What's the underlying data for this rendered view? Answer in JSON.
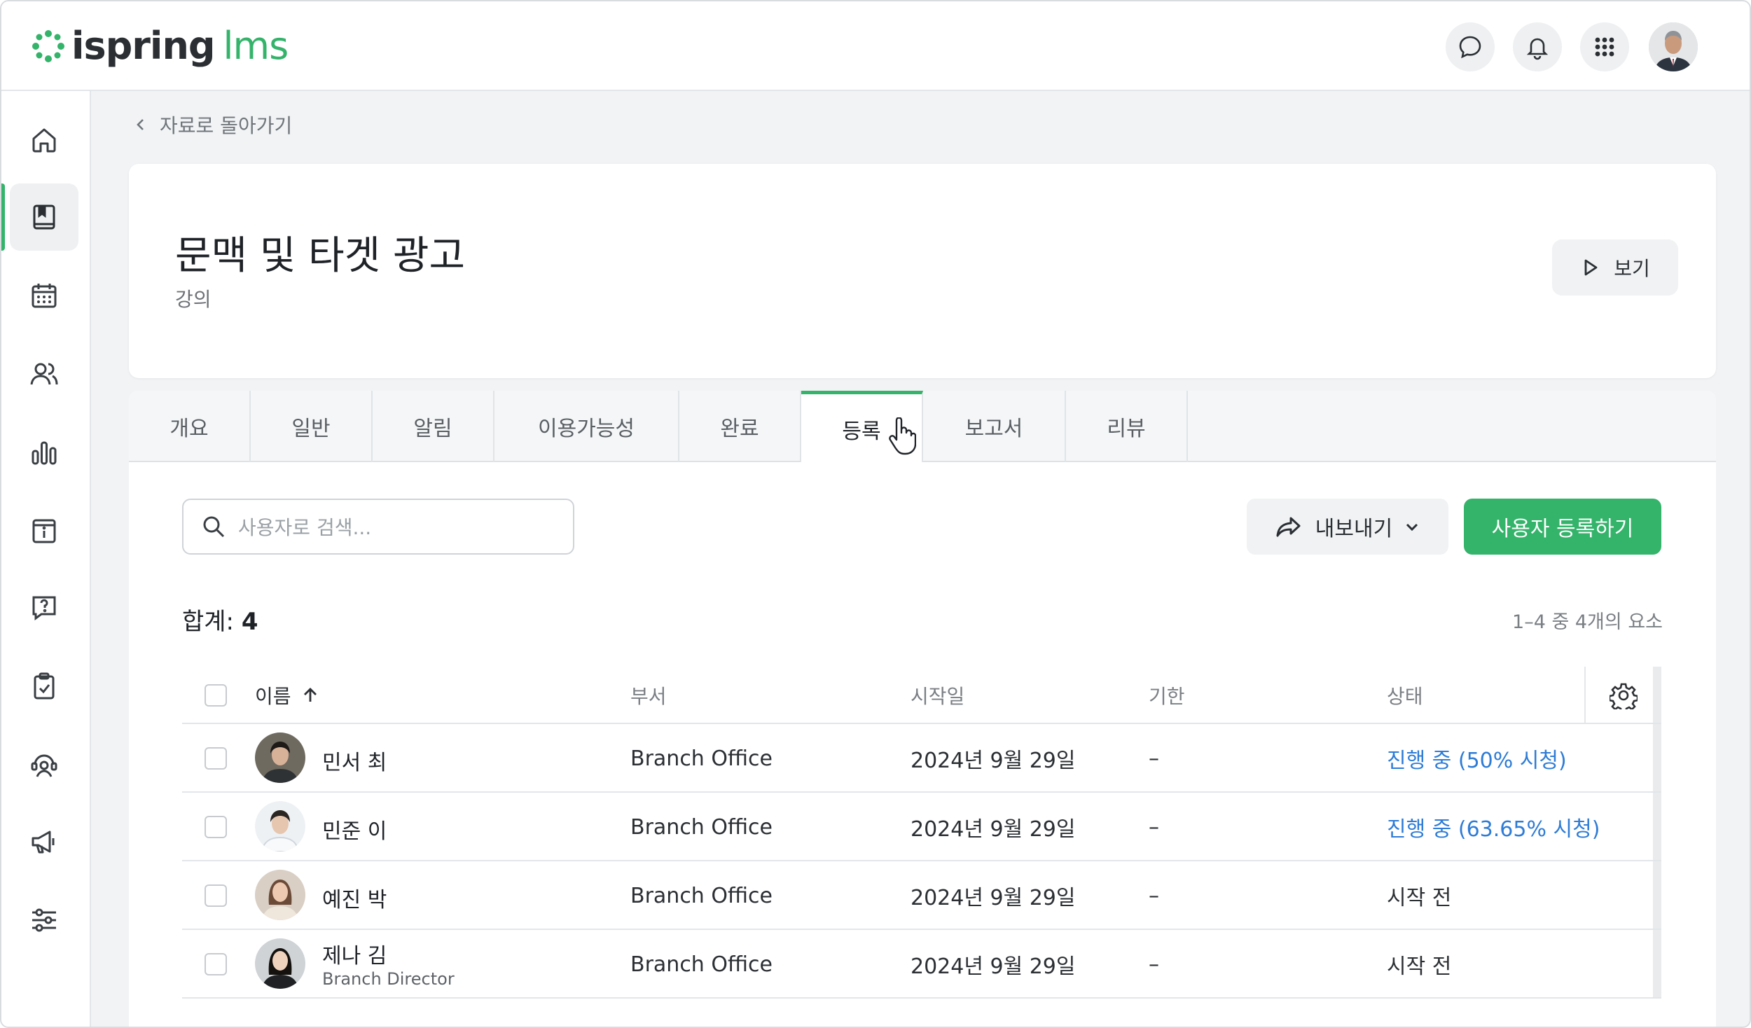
{
  "app": {
    "logo_primary": "ispring",
    "logo_secondary": "lms",
    "brand_color": "#34b36a"
  },
  "topbar": {
    "icons": [
      "chat-icon",
      "bell-icon",
      "apps-grid-icon"
    ],
    "avatar": "user-avatar"
  },
  "sidebar": {
    "items": [
      {
        "icon": "home-icon",
        "active": false
      },
      {
        "icon": "book-icon",
        "active": true
      },
      {
        "icon": "calendar-icon",
        "active": false
      },
      {
        "icon": "users-icon",
        "active": false
      },
      {
        "icon": "bar-chart-icon",
        "active": false
      },
      {
        "icon": "info-board-icon",
        "active": false
      },
      {
        "icon": "question-chat-icon",
        "active": false
      },
      {
        "icon": "clipboard-check-icon",
        "active": false
      },
      {
        "icon": "support-icon",
        "active": false
      },
      {
        "icon": "megaphone-icon",
        "active": false
      },
      {
        "icon": "sliders-icon",
        "active": false
      }
    ]
  },
  "breadcrumb": {
    "label": "자료로 돌아가기"
  },
  "header": {
    "title": "문맥 및 타겟 광고",
    "subtitle": "강의",
    "view_button": "보기"
  },
  "tabs": [
    {
      "label": "개요"
    },
    {
      "label": "일반"
    },
    {
      "label": "알림"
    },
    {
      "label": "이용가능성"
    },
    {
      "label": "완료"
    },
    {
      "label": "등록",
      "active": true
    },
    {
      "label": "보고서"
    },
    {
      "label": "리뷰"
    }
  ],
  "toolbar": {
    "search_placeholder": "사용자로 검색...",
    "export_label": "내보내기",
    "enroll_label": "사용자 등록하기"
  },
  "summary": {
    "total_label": "합계:",
    "total_value": "4",
    "range_text": "1–4 중 4개의 요소"
  },
  "table": {
    "columns": {
      "name": "이름",
      "department": "부서",
      "start_date": "시작일",
      "deadline": "기한",
      "status": "상태"
    },
    "rows": [
      {
        "name": "민서 최",
        "role": "",
        "department": "Branch Office",
        "start_date": "2024년 9월 29일",
        "deadline": "–",
        "status": "진행 중 (50% 시청)",
        "status_link": true
      },
      {
        "name": "민준 이",
        "role": "",
        "department": "Branch Office",
        "start_date": "2024년 9월 29일",
        "deadline": "–",
        "status": "진행 중 (63.65% 시청)",
        "status_link": true
      },
      {
        "name": "예진 박",
        "role": "",
        "department": "Branch Office",
        "start_date": "2024년 9월 29일",
        "deadline": "–",
        "status": "시작 전",
        "status_link": false
      },
      {
        "name": "제나 김",
        "role": "Branch Director",
        "department": "Branch Office",
        "start_date": "2024년 9월 29일",
        "deadline": "–",
        "status": "시작 전",
        "status_link": false
      }
    ]
  }
}
